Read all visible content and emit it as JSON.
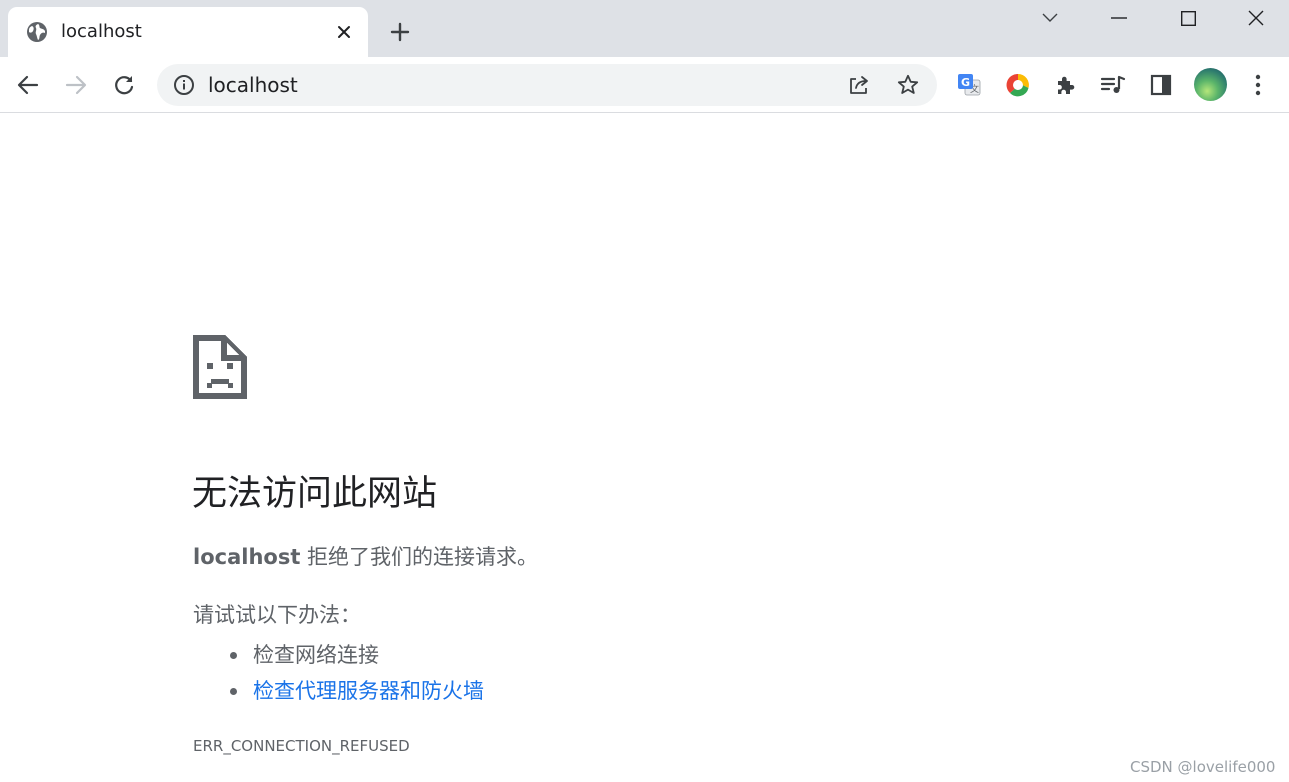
{
  "tab": {
    "title": "localhost"
  },
  "omnibox": {
    "url": "localhost"
  },
  "error": {
    "title": "无法访问此网站",
    "host": "localhost",
    "message": " 拒绝了我们的连接请求。",
    "try_label": "请试试以下办法：",
    "suggestions": [
      {
        "text": "检查网络连接",
        "is_link": false
      },
      {
        "text": "检查代理服务器和防火墙",
        "is_link": true
      }
    ],
    "code": "ERR_CONNECTION_REFUSED"
  },
  "watermark": "CSDN @lovelife000",
  "icons": {
    "tab": [
      "globe-icon",
      "close-icon",
      "plus-icon"
    ],
    "window": [
      "chevron-down-icon",
      "minimize-icon",
      "maximize-icon",
      "close-icon"
    ],
    "toolbar": [
      "back-arrow-icon",
      "forward-arrow-icon",
      "reload-icon",
      "info-icon",
      "share-icon",
      "star-icon",
      "google-translate-icon",
      "chrome-ring-icon",
      "puzzle-icon",
      "media-queue-icon",
      "side-panel-icon",
      "kebab-menu-icon"
    ],
    "content": [
      "sad-page-icon"
    ]
  },
  "colors": {
    "tabstrip_bg": "#dee1e6",
    "omnibox_bg": "#f1f3f4",
    "text_primary": "#202124",
    "text_secondary": "#5f6368",
    "link": "#1a73e8"
  }
}
